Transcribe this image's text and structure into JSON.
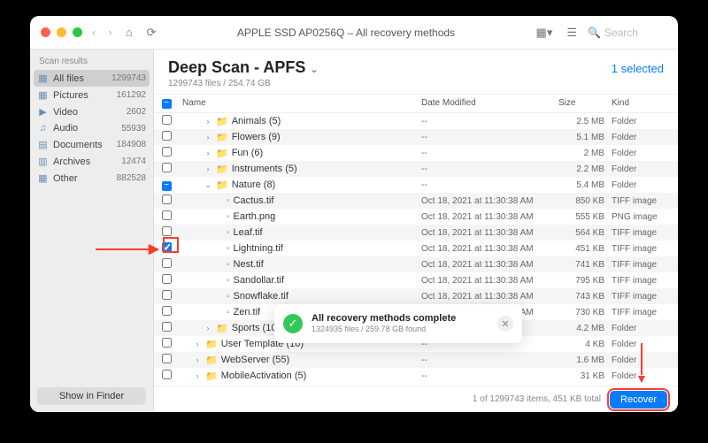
{
  "titlebar": {
    "device": "APPLE SSD AP0256Q – All recovery methods",
    "search_placeholder": "Search"
  },
  "sidebar": {
    "header": "Scan results",
    "items": [
      {
        "icon": "▦",
        "label": "All files",
        "count": "1299743",
        "sel": true
      },
      {
        "icon": "▦",
        "label": "Pictures",
        "count": "161292"
      },
      {
        "icon": "▶",
        "label": "Video",
        "count": "2602"
      },
      {
        "icon": "♫",
        "label": "Audio",
        "count": "55939"
      },
      {
        "icon": "▤",
        "label": "Documents",
        "count": "184908"
      },
      {
        "icon": "▥",
        "label": "Archives",
        "count": "12474"
      },
      {
        "icon": "▦",
        "label": "Other",
        "count": "882528"
      }
    ],
    "show_finder": "Show in Finder"
  },
  "header": {
    "title": "Deep Scan - APFS",
    "subtitle": "1299743 files / 254.74 GB",
    "selected": "1 selected"
  },
  "columns": {
    "name": "Name",
    "date": "Date Modified",
    "size": "Size",
    "kind": "Kind"
  },
  "rows": [
    {
      "depth": 1,
      "chev": "›",
      "folder": true,
      "name": "Animals (5)",
      "date": "--",
      "size": "2.5 MB",
      "kind": "Folder",
      "chk": "none"
    },
    {
      "depth": 1,
      "chev": "›",
      "folder": true,
      "name": "Flowers (9)",
      "date": "--",
      "size": "5.1 MB",
      "kind": "Folder",
      "chk": "none"
    },
    {
      "depth": 1,
      "chev": "›",
      "folder": true,
      "name": "Fun (6)",
      "date": "--",
      "size": "2 MB",
      "kind": "Folder",
      "chk": "none"
    },
    {
      "depth": 1,
      "chev": "›",
      "folder": true,
      "name": "Instruments (5)",
      "date": "--",
      "size": "2.2 MB",
      "kind": "Folder",
      "chk": "none"
    },
    {
      "depth": 1,
      "chev": "⌄",
      "folder": true,
      "name": "Nature (8)",
      "date": "--",
      "size": "5.4 MB",
      "kind": "Folder",
      "chk": "minus"
    },
    {
      "depth": 2,
      "folder": false,
      "name": "Cactus.tif",
      "date": "Oct 18, 2021 at 11:30:38 AM",
      "size": "850 KB",
      "kind": "TIFF image",
      "chk": "none"
    },
    {
      "depth": 2,
      "folder": false,
      "name": "Earth.png",
      "date": "Oct 18, 2021 at 11:30:38 AM",
      "size": "555 KB",
      "kind": "PNG image",
      "chk": "none"
    },
    {
      "depth": 2,
      "folder": false,
      "name": "Leaf.tif",
      "date": "Oct 18, 2021 at 11:30:38 AM",
      "size": "564 KB",
      "kind": "TIFF image",
      "chk": "none"
    },
    {
      "depth": 2,
      "folder": false,
      "name": "Lightning.tif",
      "date": "Oct 18, 2021 at 11:30:38 AM",
      "size": "451 KB",
      "kind": "TIFF image",
      "chk": "checked"
    },
    {
      "depth": 2,
      "folder": false,
      "name": "Nest.tif",
      "date": "Oct 18, 2021 at 11:30:38 AM",
      "size": "741 KB",
      "kind": "TIFF image",
      "chk": "none"
    },
    {
      "depth": 2,
      "folder": false,
      "name": "Sandollar.tif",
      "date": "Oct 18, 2021 at 11:30:38 AM",
      "size": "795 KB",
      "kind": "TIFF image",
      "chk": "none"
    },
    {
      "depth": 2,
      "folder": false,
      "name": "Snowflake.tif",
      "date": "Oct 18, 2021 at 11:30:38 AM",
      "size": "743 KB",
      "kind": "TIFF image",
      "chk": "none"
    },
    {
      "depth": 2,
      "folder": false,
      "name": "Zen.tif",
      "date": "Oct 18, 2021 at 11:30:38 AM",
      "size": "730 KB",
      "kind": "TIFF image",
      "chk": "none"
    },
    {
      "depth": 1,
      "chev": "›",
      "folder": true,
      "name": "Sports (10)",
      "date": "--",
      "size": "4.2 MB",
      "kind": "Folder",
      "chk": "none"
    },
    {
      "depth": 0,
      "chev": "›",
      "folder": true,
      "name": "User Template (10)",
      "date": "--",
      "size": "4 KB",
      "kind": "Folder",
      "chk": "none"
    },
    {
      "depth": 0,
      "chev": "›",
      "folder": true,
      "name": "WebServer (55)",
      "date": "--",
      "size": "1.6 MB",
      "kind": "Folder",
      "chk": "none"
    },
    {
      "depth": 0,
      "chev": "›",
      "folder": true,
      "name": "MobileActivation (5)",
      "date": "--",
      "size": "31 KB",
      "kind": "Folder",
      "chk": "none"
    }
  ],
  "popup": {
    "title": "All recovery methods complete",
    "sub": "1324935 files / 259.78 GB found"
  },
  "footer": {
    "status": "1 of 1299743 items, 451 KB total",
    "recover": "Recover"
  }
}
